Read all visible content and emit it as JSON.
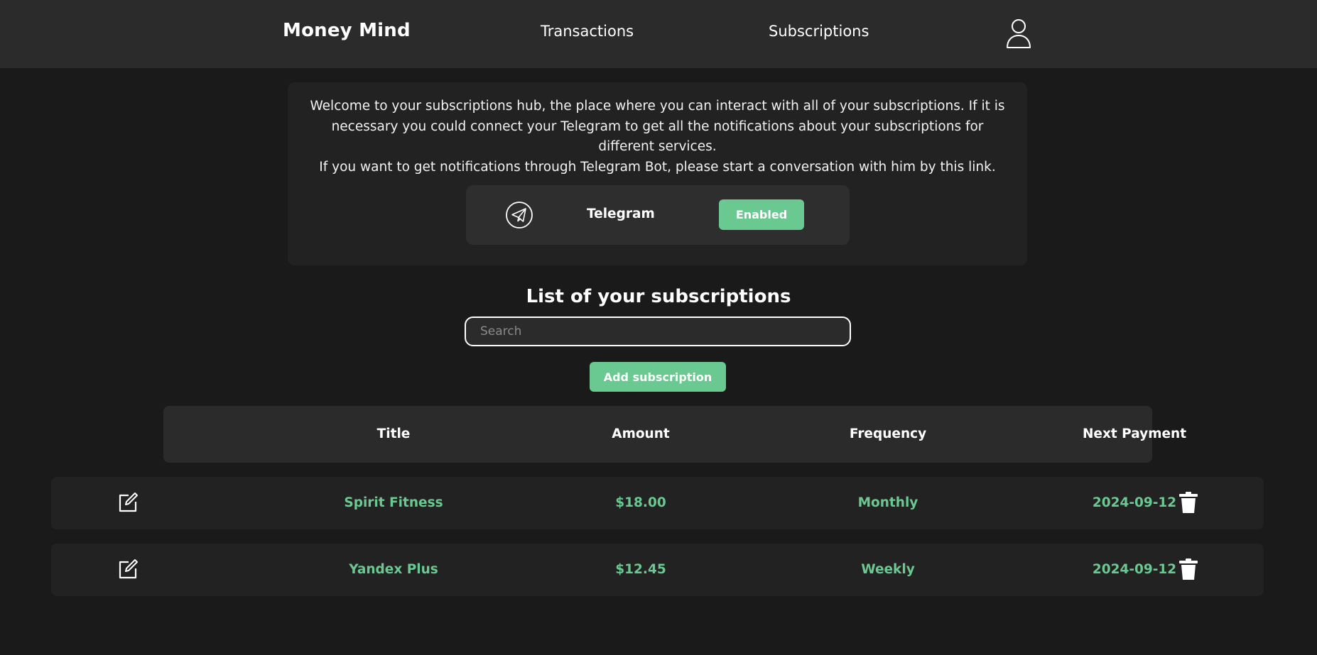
{
  "header": {
    "brand": "Money Mind",
    "nav": {
      "transactions": "Transactions",
      "subscriptions": "Subscriptions"
    },
    "user_icon": "user-icon"
  },
  "info": {
    "lines": [
      "Welcome to your subscriptions hub, the place where you can interact with all of your subscriptions. If it is necessary you could connect your Telegram to get all the notifications about your subscriptions for different services.",
      "If you want to get notifications through Telegram Bot, please start a conversation with him by this link."
    ],
    "telegram": {
      "icon": "telegram-icon",
      "label": "Telegram",
      "status": "Enabled"
    }
  },
  "list": {
    "title": "List of your subscriptions",
    "search_placeholder": "Search",
    "add_label": "Add subscription"
  },
  "table": {
    "columns": [
      "Title",
      "Amount",
      "Frequency",
      "Next Payment"
    ],
    "rows": [
      {
        "title": "Spirit Fitness",
        "amount": "$18.00",
        "frequency": "Monthly",
        "next_payment": "2024-09-12"
      },
      {
        "title": "Yandex Plus",
        "amount": "$12.45",
        "frequency": "Weekly",
        "next_payment": "2024-09-12"
      }
    ]
  },
  "colors": {
    "background": "#1a1a1a",
    "header": "#2b2b2b",
    "card": "#222222",
    "accent": "#6ac990",
    "text": "#ffffff"
  }
}
